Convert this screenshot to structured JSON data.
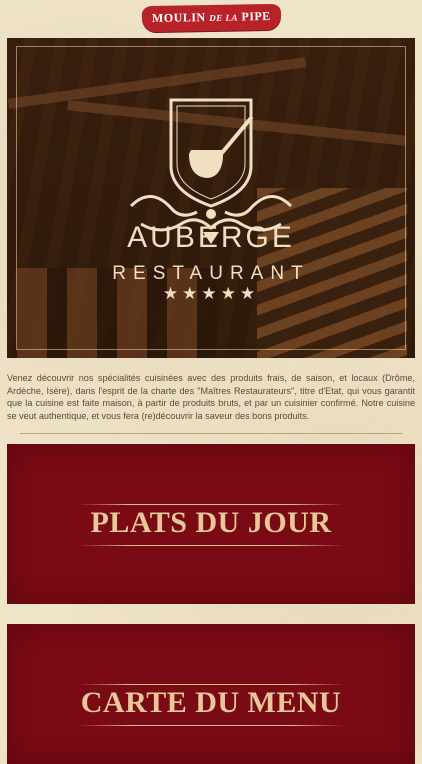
{
  "header": {
    "logo_main": "MOULIN",
    "logo_small": "DE LA",
    "logo_end": "PIPE"
  },
  "hero": {
    "line1": "AUBERGE",
    "line2": "RESTAURANT",
    "stars": "★★★★★",
    "rating": 5
  },
  "intro": {
    "text": "Venez découvrir nos spécialités cuisinées avec des produits frais, de saison, et locaux (Drôme, Ardèche, Isère), dans l'esprit de la charte des \"Maîtres Restaurateurs\", titre d'Etat, qui vous garantit que la cuisine est faite maison, à partir de produits bruts, et par un cuisinier confirmé. Notre cuisine se veut authentique, et vous fera (re)découvrir la saveur des bons produits."
  },
  "cards": {
    "plats_du_jour": "PLATS DU JOUR",
    "carte_du_menu": "CARTE DU MENU"
  },
  "colors": {
    "background": "#efe3c8",
    "card_red": "#7a0a14",
    "card_text": "#e8c89a",
    "logo_red": "#b8232a"
  }
}
